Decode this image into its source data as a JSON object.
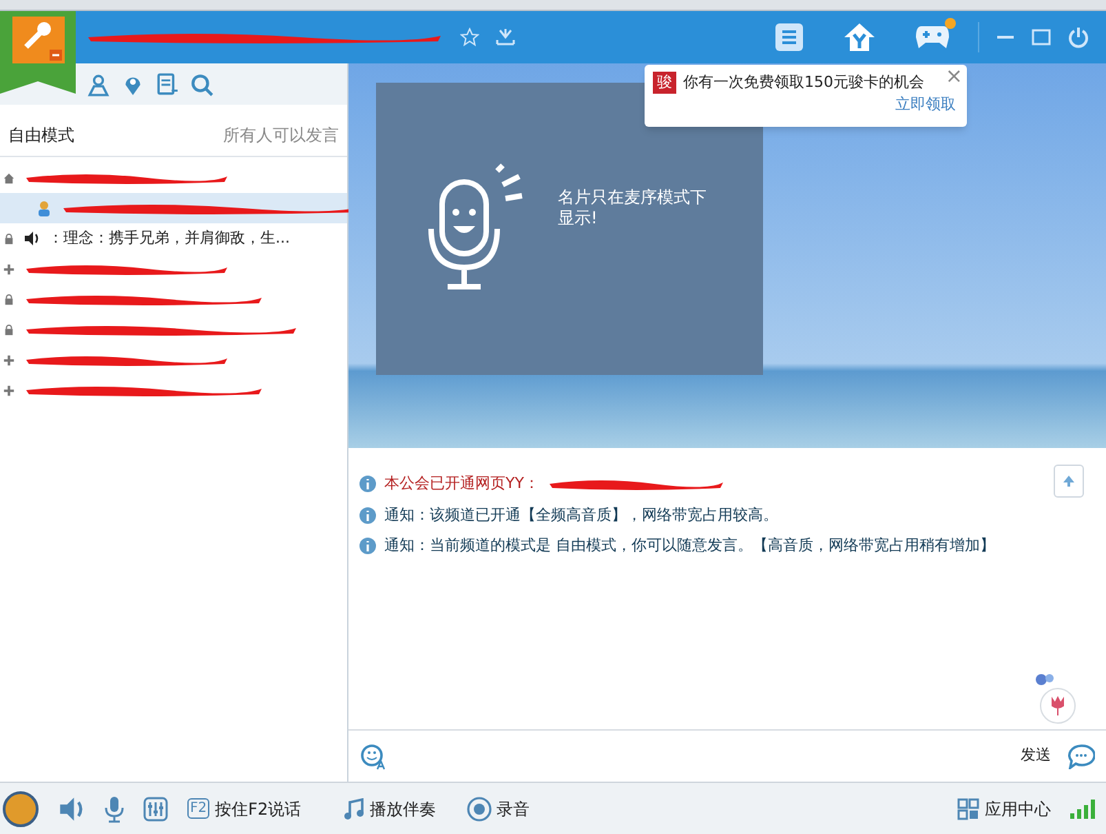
{
  "left_panel": {
    "mode": "自由模式",
    "permission": "所有人可以发言",
    "rows": [
      {
        "kind": "home",
        "selected": false,
        "speaker": false,
        "redacted": true
      },
      {
        "kind": "user",
        "selected": true,
        "speaker": false,
        "redacted": true
      },
      {
        "kind": "lock",
        "selected": false,
        "speaker": true,
        "redacted": false,
        "label": "：理念：携手兄弟，并肩御敌，生..."
      },
      {
        "kind": "plus",
        "selected": false,
        "speaker": false,
        "redacted": true
      },
      {
        "kind": "lock",
        "selected": false,
        "speaker": false,
        "redacted": true
      },
      {
        "kind": "lock",
        "selected": false,
        "speaker": false,
        "redacted": true
      },
      {
        "kind": "plus",
        "selected": false,
        "speaker": false,
        "redacted": true
      },
      {
        "kind": "plus",
        "selected": false,
        "speaker": false,
        "redacted": true
      }
    ]
  },
  "card": {
    "text": "名片只在麦序模式下显示!"
  },
  "popup": {
    "badge": "骏",
    "message": "你有一次免费领取150元骏卡的机会",
    "link": "立即领取",
    "close": "×"
  },
  "messages": [
    {
      "kind": "highlight",
      "text": "本公会已开通网页YY：",
      "redacted": true
    },
    {
      "kind": "notice",
      "text": "通知：该频道已开通【全频高音质】，网络带宽占用较高。",
      "redacted": false
    },
    {
      "kind": "notice",
      "text": "通知：当前频道的模式是 自由模式，你可以随意发言。【高音质，网络带宽占用稍有增加】",
      "redacted": false
    }
  ],
  "input": {
    "send": "发送"
  },
  "bottom_bar": {
    "f2_key": "F2",
    "talk": "按住F2说话",
    "music": "播放伴奏",
    "record": "录音",
    "apps": "应用中心"
  }
}
